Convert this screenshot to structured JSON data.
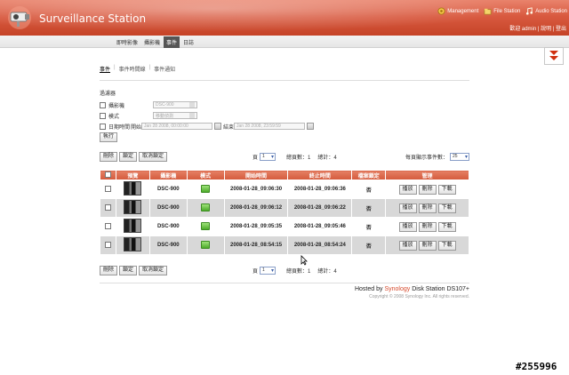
{
  "app": {
    "title": "Surveillance Station"
  },
  "top_links": [
    {
      "label": "Management",
      "icon": "management-icon"
    },
    {
      "label": "File Station",
      "icon": "file-station-icon"
    },
    {
      "label": "Audio Station",
      "icon": "audio-station-icon"
    }
  ],
  "user_line": "歡迎 admin | 說明 | 登出",
  "nav_tabs": [
    "即時影像",
    "攝影機",
    "事件",
    "日誌"
  ],
  "active_nav": "事件",
  "sub_tabs": [
    "事件",
    "事件時間線",
    "事件通知"
  ],
  "filter": {
    "title": "過濾器",
    "camera_label": "攝影機",
    "camera_value": "DSC-900",
    "mode_label": "模式",
    "mode_value": "移動偵測",
    "date_label": "日期時間",
    "start_label": "開始",
    "start_value": "Jan 28 2008, 00:00:00",
    "end_label": "結束",
    "end_value": "Jan 28 2008, 23:59:59",
    "execute_label": "執行"
  },
  "toolbar": {
    "delete_label": "刪除",
    "lock_label": "鎖定",
    "unlock_label": "取消鎖定",
    "page_label": "頁",
    "page_value": "1",
    "total_pages_label": "總頁數：",
    "total_pages_value": "1",
    "total_label": "總計：",
    "total_value": "4",
    "per_page_label": "每頁顯示事件數：",
    "per_page_value": "25"
  },
  "table": {
    "headers": [
      "",
      "預覽",
      "攝影機",
      "模式",
      "開始時間",
      "終止時間",
      "檔案鎖定",
      "管理"
    ],
    "rows": [
      {
        "camera": "DSC-900",
        "start": "2008-01-28_09:06:30",
        "end": "2008-01-28_09:06:36",
        "locked": "否"
      },
      {
        "camera": "DSC-900",
        "start": "2008-01-28_09:06:12",
        "end": "2008-01-28_09:06:22",
        "locked": "否"
      },
      {
        "camera": "DSC-900",
        "start": "2008-01-28_09:05:35",
        "end": "2008-01-28_09:05:46",
        "locked": "否"
      },
      {
        "camera": "DSC-900",
        "start": "2008-01-28_08:54:15",
        "end": "2008-01-28_08:54:24",
        "locked": "否"
      }
    ],
    "play_label": "播放",
    "delete_label": "刪除",
    "download_label": "下載"
  },
  "footer": {
    "hosted_prefix": "Hosted by",
    "brand": "Synology",
    "hosted_suffix": "Disk Station DS107+",
    "copyright": "Copyright © 2008 Synology Inc. All rights reserved."
  },
  "watermark": "#255996",
  "colors": {
    "header_red": "#d95a40",
    "table_header": "#d45a3c",
    "brand": "#d64a2d"
  }
}
